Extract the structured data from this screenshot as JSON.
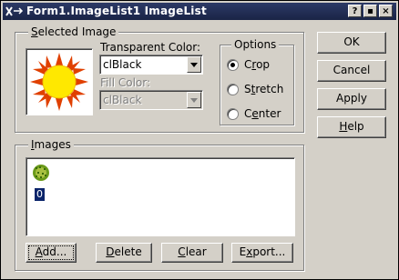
{
  "window": {
    "title": "Form1.ImageList1 ImageList",
    "help_btn": "?",
    "maximize_btn": "▪",
    "close_btn": "×"
  },
  "selected_image": {
    "group_label": "Selected Image",
    "transparent_color_label": "Transparent Color:",
    "transparent_color_value": "clBlack",
    "fill_color_label": "Fill Color:",
    "fill_color_value": "clBlack"
  },
  "options": {
    "group_label": "Options",
    "items": [
      {
        "label": "Crop",
        "checked": true
      },
      {
        "label": "Stretch",
        "checked": false
      },
      {
        "label": "Center",
        "checked": false
      }
    ]
  },
  "side_buttons": {
    "ok": "OK",
    "cancel": "Cancel",
    "apply": "Apply",
    "help": "Help"
  },
  "images": {
    "group_label": "Images",
    "items": [
      {
        "index": "0"
      }
    ],
    "add": "Add...",
    "delete": "Delete",
    "clear": "Clear",
    "export": "Export..."
  },
  "colors": {
    "title_bg": "#1a2446",
    "face": "#d4d0c8",
    "selection": "#0a246a"
  }
}
